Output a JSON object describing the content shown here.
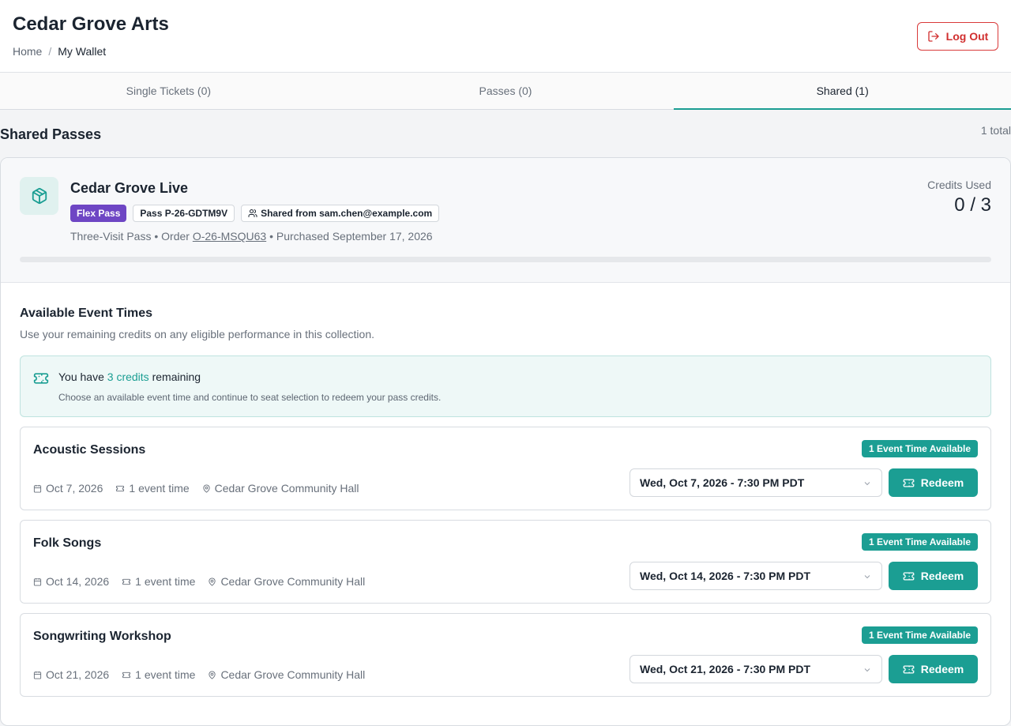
{
  "header": {
    "org_name": "Cedar Grove Arts",
    "breadcrumb": {
      "home": "Home",
      "separator": "/",
      "current": "My Wallet"
    },
    "logout_label": "Log Out"
  },
  "tabs": [
    {
      "label": "Single Tickets (0)",
      "active": false
    },
    {
      "label": "Passes (0)",
      "active": false
    },
    {
      "label": "Shared (1)",
      "active": true
    }
  ],
  "section": {
    "title": "Shared Passes",
    "count": "1 total"
  },
  "pass": {
    "name": "Cedar Grove Live",
    "badge_type": "Flex Pass",
    "badge_pass": "Pass P-26-GDTM9V",
    "badge_shared": "Shared from sam.chen@example.com",
    "meta_type": "Three-Visit Pass",
    "meta_order_label": "Order",
    "meta_order_id": "O-26-MSQU63",
    "meta_purchased": "Purchased September 17, 2026",
    "meta_separator": "•",
    "credits_label": "Credits Used",
    "credits_value": "0 / 3",
    "credits_used_fraction": 0
  },
  "available": {
    "title": "Available Event Times",
    "subtitle": "Use your remaining credits on any eligible performance in this collection.",
    "credit_prefix": "You have",
    "credit_count": "3 credits",
    "credit_suffix": "remaining",
    "credit_note": "Choose an available event time and continue to seat selection to redeem your pass credits."
  },
  "events": [
    {
      "name": "Acoustic Sessions",
      "badge": "1 Event Time Available",
      "date": "Oct 7, 2026",
      "times": "1 event time",
      "venue": "Cedar Grove Community Hall",
      "selected_time": "Wed, Oct 7, 2026 - 7:30 PM PDT",
      "redeem_label": "Redeem"
    },
    {
      "name": "Folk Songs",
      "badge": "1 Event Time Available",
      "date": "Oct 14, 2026",
      "times": "1 event time",
      "venue": "Cedar Grove Community Hall",
      "selected_time": "Wed, Oct 14, 2026 - 7:30 PM PDT",
      "redeem_label": "Redeem"
    },
    {
      "name": "Songwriting Workshop",
      "badge": "1 Event Time Available",
      "date": "Oct 21, 2026",
      "times": "1 event time",
      "venue": "Cedar Grove Community Hall",
      "selected_time": "Wed, Oct 21, 2026 - 7:30 PM PDT",
      "redeem_label": "Redeem"
    }
  ],
  "colors": {
    "accent": "#1b9e93",
    "flex_badge": "#6e46c4",
    "danger": "#d12f2f"
  }
}
